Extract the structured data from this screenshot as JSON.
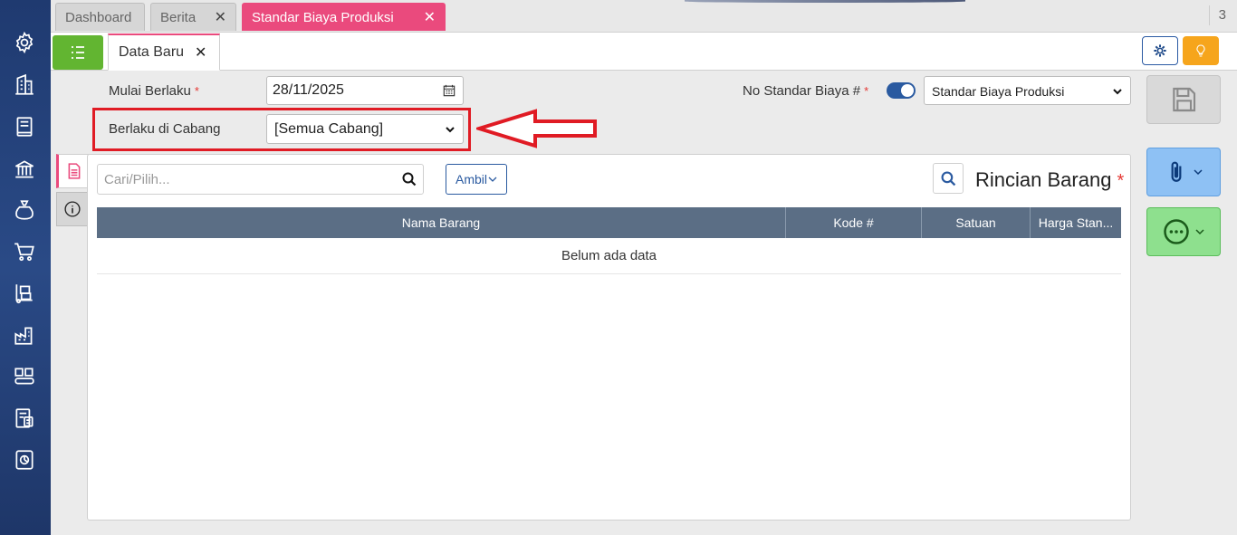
{
  "tabs": [
    {
      "label": "Dashboard"
    },
    {
      "label": "Berita"
    },
    {
      "label": "Standar Biaya Produksi"
    }
  ],
  "tab_count": "3",
  "subtab": {
    "label": "Data Baru"
  },
  "form": {
    "start_label": "Mulai Berlaku",
    "start_value": "28/11/2025",
    "branch_label": "Berlaku di Cabang",
    "branch_value": "[Semua Cabang]",
    "number_label": "No Standar Biaya #",
    "number_type_value": "Standar Biaya Produksi",
    "required_mark": "*"
  },
  "detail": {
    "search_placeholder": "Cari/Pilih...",
    "ambil_label": "Ambil",
    "title": "Rincian Barang",
    "columns": [
      "Nama Barang",
      "Kode #",
      "Satuan",
      "Harga Stan..."
    ],
    "empty_text": "Belum ada data"
  },
  "colors": {
    "accent": "#ea4a7d",
    "primary": "#2a5aa0",
    "success": "#62b531",
    "warning": "#f6a51c",
    "highlight": "#e01b24"
  },
  "sidebar_icons": [
    "gear-icon",
    "building-icon",
    "book-icon",
    "bank-icon",
    "money-bag-icon",
    "cart-icon",
    "hand-truck-icon",
    "factory-icon",
    "conveyor-icon",
    "tax-icon",
    "report-icon"
  ]
}
